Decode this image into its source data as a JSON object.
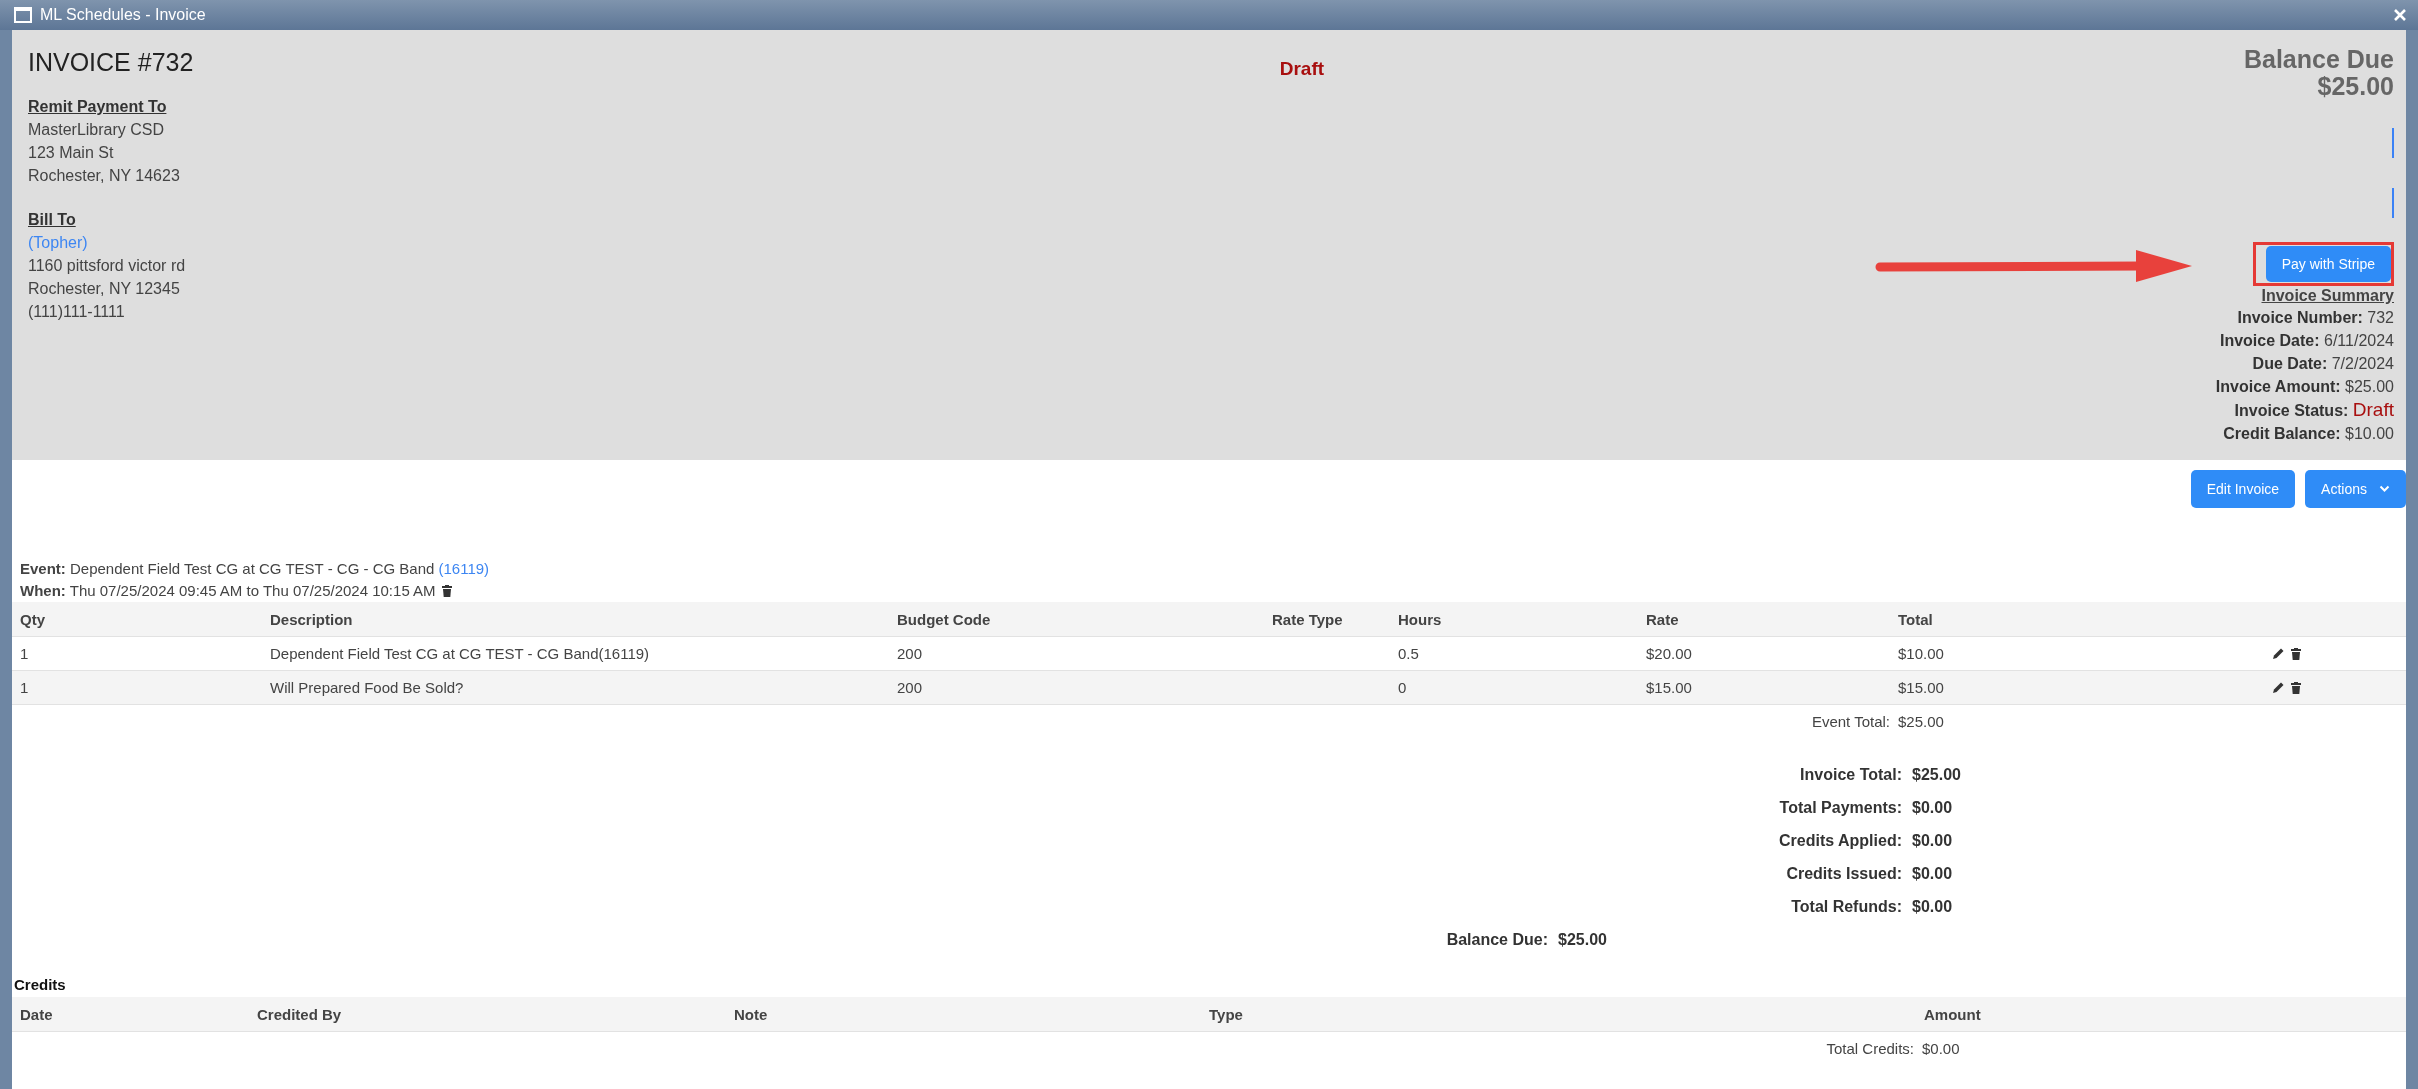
{
  "window": {
    "title": "ML Schedules - Invoice"
  },
  "header": {
    "title": "INVOICE #732",
    "status": "Draft",
    "remit": {
      "heading": "Remit Payment To",
      "lines": [
        "MasterLibrary CSD",
        "123 Main St",
        "Rochester, NY 14623"
      ]
    },
    "bill_to": {
      "heading": "Bill To",
      "name": "(Topher)",
      "lines": [
        "1160 pittsford victor rd",
        "Rochester, NY 12345",
        "(111)111-1111"
      ]
    },
    "balance_due": {
      "label": "Balance Due",
      "amount": "$25.00"
    },
    "pay_button": "Pay with Stripe",
    "summary": {
      "heading": "Invoice Summary",
      "items": [
        {
          "label": "Invoice Number:",
          "value": "732",
          "kind": "plain"
        },
        {
          "label": "Invoice Date:",
          "value": "6/11/2024",
          "kind": "plain"
        },
        {
          "label": "Due Date:",
          "value": "7/2/2024",
          "kind": "plain"
        },
        {
          "label": "Invoice Amount:",
          "value": "$25.00",
          "kind": "plain"
        },
        {
          "label": "Invoice Status:",
          "value": "Draft",
          "kind": "status"
        },
        {
          "label": "Credit Balance:",
          "value": "$10.00",
          "kind": "plain"
        }
      ]
    }
  },
  "toolbar": {
    "buttons": [
      {
        "label": "Edit Invoice",
        "kind": "plain"
      },
      {
        "label": "Actions",
        "kind": "dropdown"
      }
    ]
  },
  "event": {
    "label": "Event:",
    "text": "Dependent Field Test CG at CG TEST - CG - CG Band",
    "link": "(16119)",
    "when_label": "When:",
    "when": "Thu 07/25/2024 09:45 AM to Thu 07/25/2024 10:15 AM"
  },
  "table": {
    "columns": [
      "Qty",
      "Description",
      "Budget Code",
      "Rate Type",
      "Hours",
      "Rate",
      "Total"
    ],
    "rows": [
      {
        "cells": [
          "1",
          "Dependent Field Test CG at CG TEST - CG Band(16119)",
          "200",
          "",
          "0.5",
          "$20.00",
          "$10.00"
        ]
      },
      {
        "cells": [
          "1",
          "Will Prepared Food Be Sold?",
          "200",
          "",
          "0",
          "$15.00",
          "$15.00"
        ]
      }
    ],
    "event_total": {
      "label": "Event Total:",
      "value": "$25.00"
    }
  },
  "totals": [
    {
      "label": "Invoice Total:",
      "value": "$25.00"
    },
    {
      "label": "Total Payments:",
      "value": "$0.00"
    },
    {
      "label": "Credits Applied:",
      "value": "$0.00"
    },
    {
      "label": "Credits Issued:",
      "value": "$0.00"
    },
    {
      "label": "Total Refunds:",
      "value": "$0.00"
    }
  ],
  "balance_due": {
    "label": "Balance Due:",
    "value": "$25.00"
  },
  "credits": {
    "title": "Credits",
    "columns": [
      "Date",
      "Credited By",
      "Note",
      "Type",
      "Amount"
    ],
    "total": {
      "label": "Total Credits:",
      "value": "$0.00"
    }
  }
}
